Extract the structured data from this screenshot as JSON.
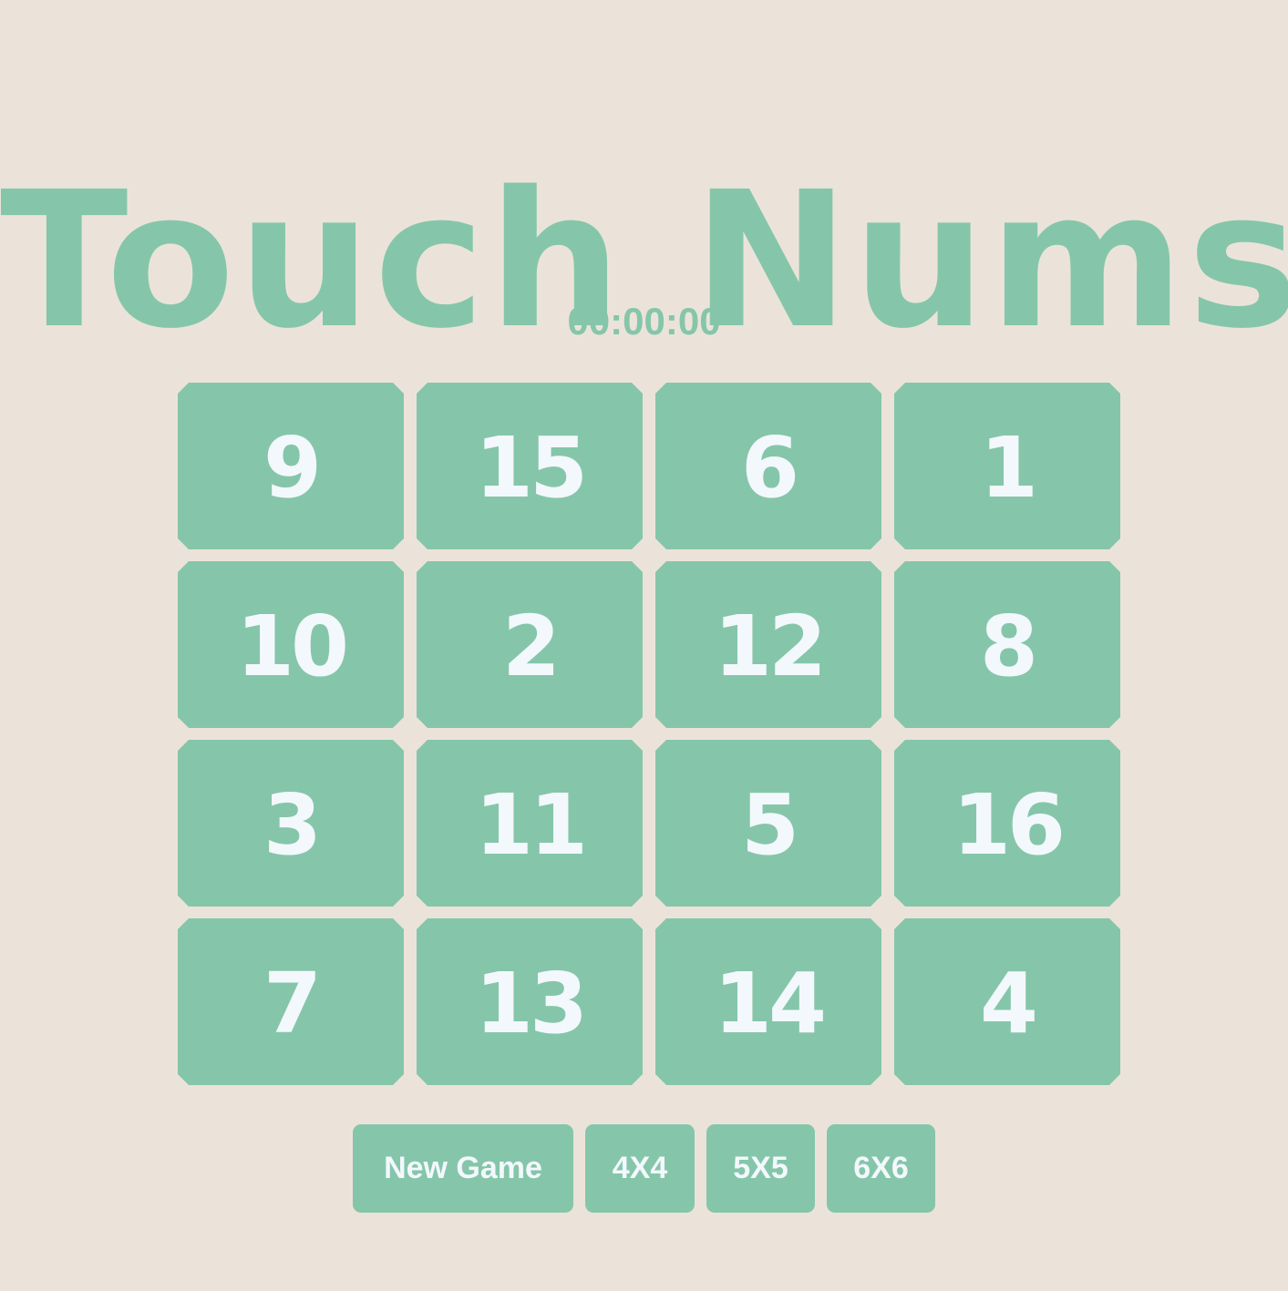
{
  "header": {
    "title": "Touch Nums",
    "timer": "00:00:00"
  },
  "board": {
    "size": "4X4",
    "cells": [
      "9",
      "15",
      "6",
      "1",
      "10",
      "2",
      "12",
      "8",
      "3",
      "11",
      "5",
      "16",
      "7",
      "13",
      "14",
      "4"
    ]
  },
  "controls": {
    "new_game_label": "New Game",
    "size_4_label": "4X4",
    "size_5_label": "5X5",
    "size_6_label": "6X6"
  },
  "colors": {
    "background": "#ebe3d9",
    "accent": "#85c6aa",
    "tile_text": "#f3f8fc"
  }
}
